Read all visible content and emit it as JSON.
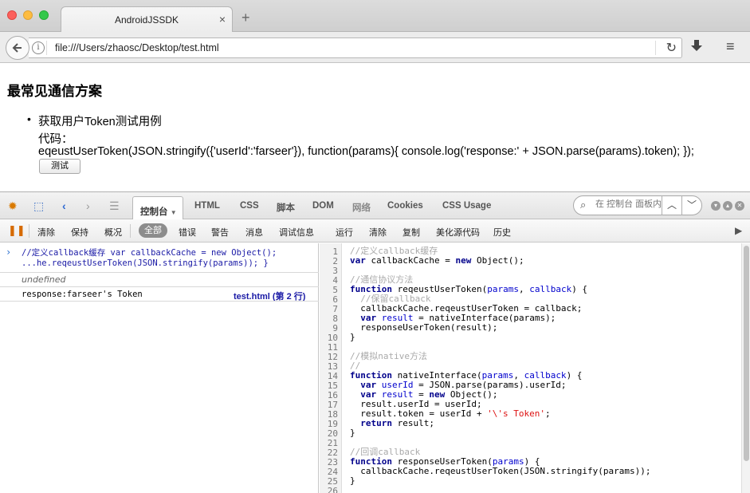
{
  "browser": {
    "tab_title": "AndroidJSSDK",
    "tab_close": "×",
    "new_tab": "+",
    "url": "file:///Users/zhaosc/Desktop/test.html"
  },
  "page": {
    "heading": "最常见通信方案",
    "list_item": "获取用户Token测试用例",
    "code_label": "代码：",
    "code_line": "eqeustUserToken(JSON.stringify({'userId':'farseer'}), function(params){ console.log('response:' + JSON.parse(params).token); });",
    "test_button": "测试"
  },
  "firebug": {
    "panels": [
      "控制台",
      "HTML",
      "CSS",
      "脚本",
      "DOM",
      "网络",
      "Cookies",
      "CSS Usage"
    ],
    "search_placeholder": "在 控制台 面板内",
    "toolbar_left": [
      "清除",
      "保持",
      "概况"
    ],
    "filters": [
      "全部",
      "错误",
      "警告",
      "消息",
      "调试信息"
    ],
    "toolbar_right": [
      "运行",
      "清除",
      "复制",
      "美化源代码",
      "历史"
    ]
  },
  "console": {
    "command_line1": "//定义callback缓存 var callbackCache = new Object();",
    "command_line2": "...he.reqeustUserToken(JSON.stringify(params)); }",
    "result": "undefined",
    "log_message": "response:farseer's Token",
    "log_source": "test.html (第 2 行)"
  },
  "editor": {
    "line_numbers": [
      "1",
      "2",
      "3",
      "4",
      "5",
      "6",
      "7",
      "8",
      "9",
      "10",
      "11",
      "12",
      "13",
      "14",
      "15",
      "16",
      "17",
      "18",
      "19",
      "20",
      "21",
      "22",
      "23",
      "24",
      "25",
      "26"
    ],
    "lines": [
      "//定义callback缓存",
      "var callbackCache = new Object();",
      "",
      "//通信协议方法",
      "function reqeustUserToken(params, callback) {",
      "  //保留callback",
      "  callbackCache.reqeustUserToken = callback;",
      "  var result = nativeInterface(params);",
      "  responseUserToken(result);",
      "}",
      "",
      "//模拟native方法",
      "//",
      "function nativeInterface(params, callback) {",
      "  var userId = JSON.parse(params).userId;",
      "  var result = new Object();",
      "  result.userId = userId;",
      "  result.token = userId + '\\'s Token';",
      "  return result;",
      "}",
      "",
      "//回调callback",
      "function responseUserToken(params) {",
      "  callbackCache.reqeustUserToken(JSON.stringify(params));",
      "}",
      ""
    ]
  },
  "colors": {
    "keyword": "#00008b",
    "param": "#0000cd",
    "comment": "#aaaaaa",
    "string": "#dd1111"
  }
}
